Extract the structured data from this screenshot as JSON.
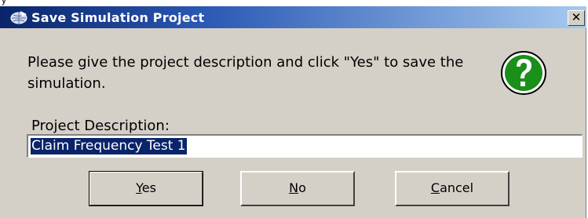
{
  "window": {
    "title": "Save Simulation Project",
    "close_glyph": "✕",
    "icon": "save-globe-icon"
  },
  "top_fragment": "y",
  "message": "Please give the project description and click \"Yes\" to save the simulation.",
  "status_icon": "question-icon",
  "status_icon_color": "#1a8f1a",
  "description": {
    "label": "Project Description:",
    "value": "Claim Frequency Test 1"
  },
  "buttons": {
    "yes": {
      "mnemonic": "Y",
      "rest": "es"
    },
    "no": {
      "mnemonic": "N",
      "rest": "o"
    },
    "cancel": {
      "mnemonic": "C",
      "rest": "ancel"
    }
  },
  "colors": {
    "titlebar_start": "#0a246a",
    "titlebar_end": "#a6caf0",
    "dialog_bg": "#d4d0c8",
    "selection": "#0a246a"
  }
}
